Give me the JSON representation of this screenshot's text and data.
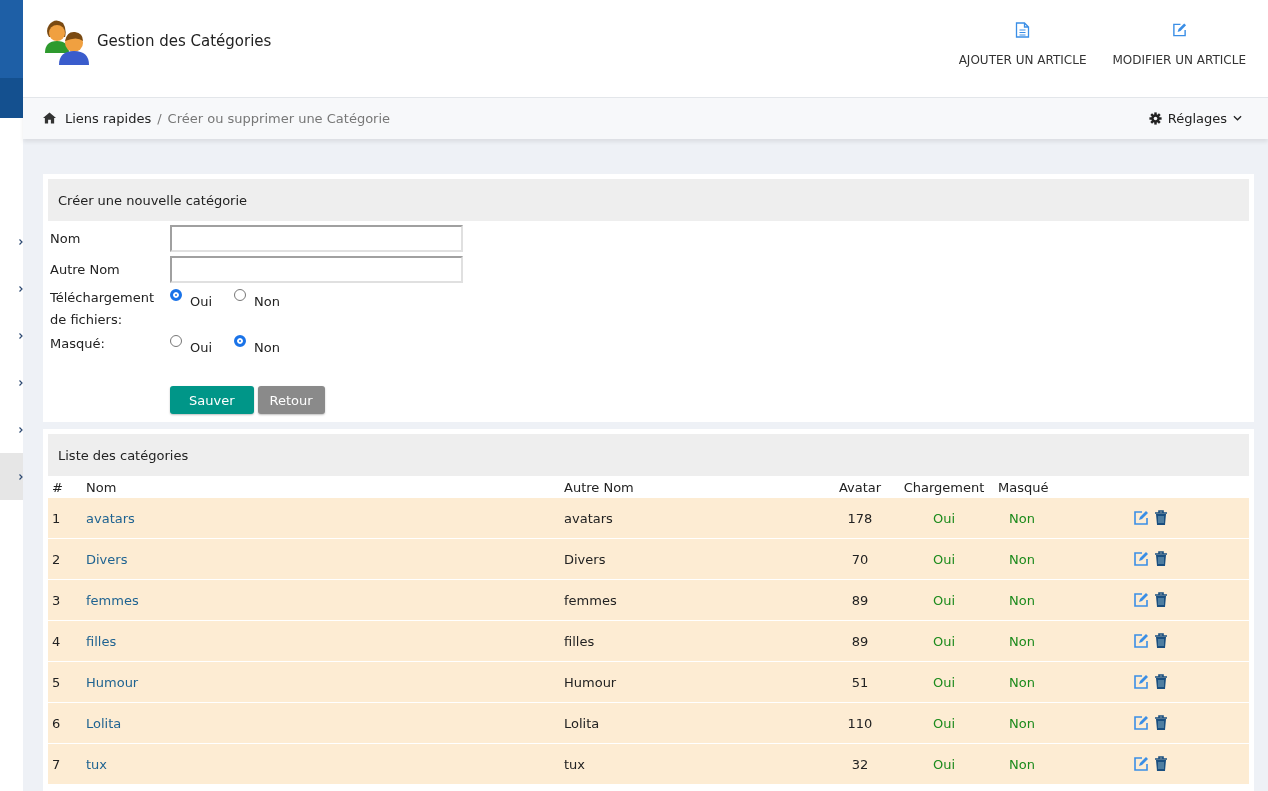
{
  "sidebar": {
    "items": [
      {
        "selected": false
      },
      {
        "selected": false
      },
      {
        "selected": false
      },
      {
        "selected": false
      },
      {
        "selected": false
      },
      {
        "selected": true
      }
    ]
  },
  "header": {
    "title": "Gestion des Catégories",
    "actions": [
      {
        "label": "AJOUTER UN ARTICLE",
        "kind": "add"
      },
      {
        "label": "MODIFIER UN ARTICLE",
        "kind": "edit"
      }
    ]
  },
  "breadcrumb": {
    "items": [
      "Liens rapides",
      "Créer ou supprimer une Catégorie"
    ],
    "separator": "/",
    "settings": "Réglages"
  },
  "form": {
    "title": "Créer une nouvelle catégorie",
    "fields": [
      {
        "label": "Nom"
      },
      {
        "label": "Autre Nom"
      }
    ],
    "radios": [
      {
        "label": "Téléchargement de fichiers:",
        "options": [
          {
            "label": "Oui",
            "selected": true
          },
          {
            "label": "Non",
            "selected": false
          }
        ]
      },
      {
        "label": "Masqué:",
        "options": [
          {
            "label": "Oui",
            "selected": false
          },
          {
            "label": "Non",
            "selected": true
          }
        ]
      }
    ],
    "buttons": [
      {
        "label": "Sauver",
        "kind": "primary"
      },
      {
        "label": "Retour",
        "kind": "secondary"
      }
    ]
  },
  "table": {
    "title": "Liste des catégories",
    "columns": [
      "#",
      "Nom",
      "Autre Nom",
      "Avatar",
      "Chargement",
      "Masqué"
    ],
    "rows": [
      {
        "num": "1",
        "name": "avatars",
        "other": "avatars",
        "avatar": "178",
        "upload": "Oui",
        "hidden": "Non"
      },
      {
        "num": "2",
        "name": "Divers",
        "other": "Divers",
        "avatar": "70",
        "upload": "Oui",
        "hidden": "Non"
      },
      {
        "num": "3",
        "name": "femmes",
        "other": "femmes",
        "avatar": "89",
        "upload": "Oui",
        "hidden": "Non"
      },
      {
        "num": "4",
        "name": "filles",
        "other": "filles",
        "avatar": "89",
        "upload": "Oui",
        "hidden": "Non"
      },
      {
        "num": "5",
        "name": "Humour",
        "other": "Humour",
        "avatar": "51",
        "upload": "Oui",
        "hidden": "Non"
      },
      {
        "num": "6",
        "name": "Lolita",
        "other": "Lolita",
        "avatar": "110",
        "upload": "Oui",
        "hidden": "Non"
      },
      {
        "num": "7",
        "name": "tux",
        "other": "tux",
        "avatar": "32",
        "upload": "Oui",
        "hidden": "Non"
      }
    ]
  }
}
